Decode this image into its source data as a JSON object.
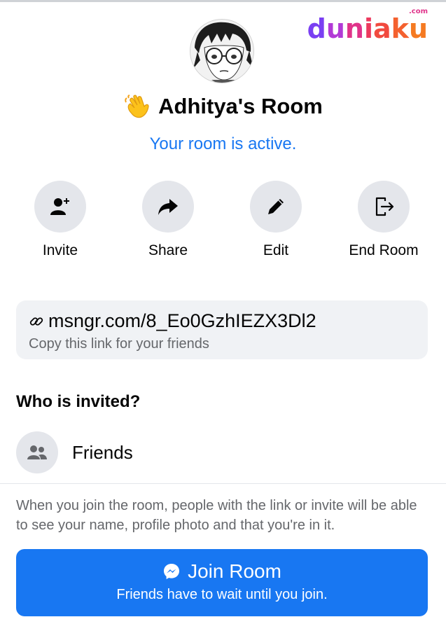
{
  "watermark": {
    "brand": "duniaku",
    "domain": ".com"
  },
  "room": {
    "title": "Adhitya's Room",
    "status": "Your room is active."
  },
  "actions": [
    {
      "label": "Invite",
      "icon": "add-person-icon"
    },
    {
      "label": "Share",
      "icon": "share-arrow-icon"
    },
    {
      "label": "Edit",
      "icon": "pencil-icon"
    },
    {
      "label": "End Room",
      "icon": "exit-door-icon"
    }
  ],
  "link": {
    "url": "msngr.com/8_Eo0GzhIEZX3Dl2",
    "hint": "Copy this link for your friends"
  },
  "invited": {
    "heading": "Who is invited?",
    "audience": "Friends",
    "icon": "people-icon"
  },
  "notice": "When you join the room, people with the link or invite will be able to see your name, profile photo and that you're in it.",
  "join": {
    "label": "Join Room",
    "sublabel": "Friends have to wait until you join.",
    "icon": "messenger-icon"
  },
  "colors": {
    "accent": "#1877f2",
    "icon_bg": "#e4e6eb",
    "secondary_text": "#65676b",
    "link_box_bg": "#f0f2f5"
  }
}
